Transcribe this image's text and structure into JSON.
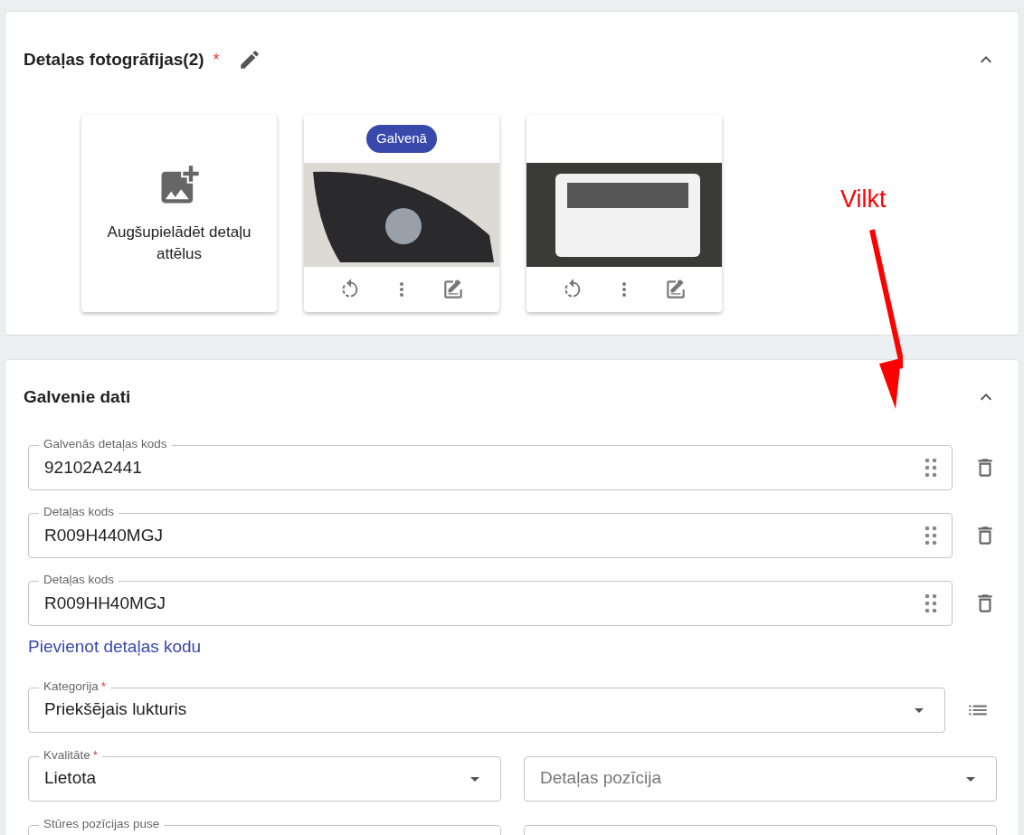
{
  "photos_section": {
    "title": "Detaļas fotogrāfijas(2)",
    "required_mark": "*",
    "expanded": true,
    "upload": {
      "label": "Augšupielādēt detaļu attēlus"
    },
    "photos": [
      {
        "badge": "Galvenā",
        "kind": "headlight"
      },
      {
        "kind": "label-sticker"
      }
    ]
  },
  "annotation": {
    "text": "Vilkt"
  },
  "main_section": {
    "title": "Galvenie dati",
    "expanded": true,
    "codes": [
      {
        "label": "Galvenās detaļas kods",
        "value": "92102A2441"
      },
      {
        "label": "Detaļas kods",
        "value": "R009H440MGJ"
      },
      {
        "label": "Detaļas kods",
        "value": "R009HH40MGJ"
      }
    ],
    "add_code_link": "Pievienot detaļas kodu",
    "field_rows": [
      {
        "list_button": true,
        "fields": [
          {
            "kind": "select",
            "label": "Kategorija",
            "required_mark": "*",
            "value": "Priekšējais lukturis"
          }
        ]
      },
      {
        "list_button": false,
        "fields": [
          {
            "kind": "select",
            "label": "Kvalitāte",
            "required_mark": "*",
            "value": "Lietota"
          },
          {
            "kind": "select",
            "placeholder": "Detaļas pozīcija"
          }
        ]
      },
      {
        "list_button": false,
        "fields": [
          {
            "kind": "select",
            "label": "Stūres pozīcijas puse"
          },
          {
            "kind": "text"
          }
        ]
      }
    ]
  }
}
